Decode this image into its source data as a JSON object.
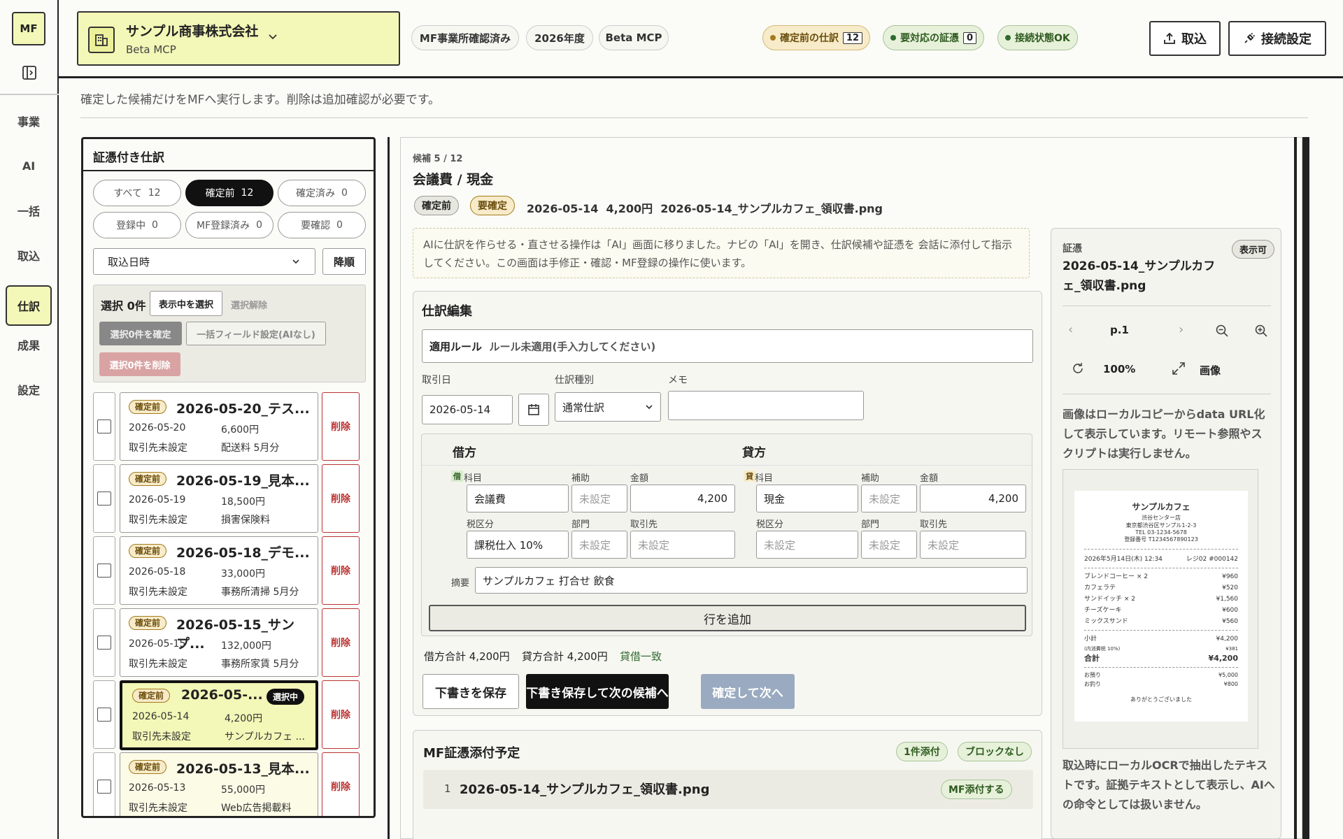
{
  "nav": {
    "logo": "MF",
    "items": [
      "事業",
      "AI",
      "一括",
      "取込",
      "仕訳",
      "成果",
      "設定"
    ],
    "active_index": 4
  },
  "header": {
    "company": "サンプル商事株式会社",
    "company_sub": "Beta MCP",
    "chips": [
      "MF事業所確認済み",
      "2026年度",
      "Beta MCP"
    ],
    "stats": [
      {
        "label": "確定前の仕訳",
        "count": "12",
        "color": "#a57a1b"
      },
      {
        "label": "要対応の証憑",
        "count": "0",
        "color": "#2f6b2f"
      },
      {
        "label": "接続状態OK",
        "count": "",
        "color": "#2f6b2f"
      }
    ],
    "import_btn": "取込",
    "connect_btn": "接続設定"
  },
  "page": {
    "desc": "確定した候補だけをMFへ実行します。削除は追加確認が必要です。"
  },
  "list": {
    "title": "証憑付き仕訳",
    "filters": [
      {
        "label": "すべて",
        "count": "12"
      },
      {
        "label": "確定前",
        "count": "12"
      },
      {
        "label": "確定済み",
        "count": "0"
      },
      {
        "label": "登録中",
        "count": "0"
      },
      {
        "label": "MF登録済み",
        "count": "0"
      },
      {
        "label": "要確認",
        "count": "0"
      }
    ],
    "sort_select": "取込日時",
    "sort_order": "降順",
    "selected": "選択 0件",
    "select_visible": "表示中を選択",
    "deselect": "選択解除",
    "confirm_selected": "選択0件を確定",
    "bulk_field": "一括フィールド設定(AIなし)",
    "delete_selected": "選択0件を削除",
    "delete_label": "削除",
    "selected_badge": "選択中",
    "items": [
      {
        "status": "確定前",
        "title": "2026-05-20_テス...",
        "date": "2026-05-20",
        "amount": "6,600円",
        "partner": "取引先未設定",
        "memo": "配送料 5月分"
      },
      {
        "status": "確定前",
        "title": "2026-05-19_見本...",
        "date": "2026-05-19",
        "amount": "18,500円",
        "partner": "取引先未設定",
        "memo": "損害保険料"
      },
      {
        "status": "確定前",
        "title": "2026-05-18_デモ...",
        "date": "2026-05-18",
        "amount": "33,000円",
        "partner": "取引先未設定",
        "memo": "事務所清掃 5月分"
      },
      {
        "status": "確定前",
        "title": "2026-05-15_サンプ...",
        "date": "2026-05-15",
        "amount": "132,000円",
        "partner": "取引先未設定",
        "memo": "事務所家賃 5月分"
      },
      {
        "status": "確定前",
        "title": "2026-05-...",
        "date": "2026-05-14",
        "amount": "4,200円",
        "partner": "取引先未設定",
        "memo": "サンプルカフェ ..."
      },
      {
        "status": "確定前",
        "title": "2026-05-13_見本...",
        "date": "2026-05-13",
        "amount": "55,000円",
        "partner": "取引先未設定",
        "memo": "Web広告掲載料"
      }
    ]
  },
  "detail": {
    "candidate": "候補 5 / 12",
    "title": "会議費 / 現金",
    "tags": [
      "確定前",
      "要確定"
    ],
    "summary": "2026-05-14  4,200円  2026-05-14_サンプルカフェ_領収書.png",
    "notice": "AIに仕訳を作らせる・直させる操作は「AI」画面に移りました。ナビの「AI」を開き、仕訳候補や証憑を 会話に添付して指示してください。この画面は手修正・確認・MF登録の操作に使います。",
    "edit_title": "仕訳編集",
    "rule_label": "適用ルール",
    "rule_value": "ルール未適用(手入力してください)",
    "date_label": "取引日",
    "date_value": "2026-05-14",
    "type_label": "仕訳種別",
    "type_value": "通常仕訳",
    "memo_label": "メモ",
    "debit": "借方",
    "credit": "貸方",
    "debit_mark": "借",
    "credit_mark": "貸",
    "col_account": "科目",
    "col_sub": "補助",
    "col_amount": "金額",
    "col_tax": "税区分",
    "col_dept": "部門",
    "col_partner": "取引先",
    "unset": "未設定",
    "debit_account": "会議費",
    "debit_amount": "4,200",
    "debit_tax": "課税仕入 10%",
    "credit_account": "現金",
    "credit_amount": "4,200",
    "summary_label": "摘要",
    "summary_value": "サンプルカフェ 打合せ 飲食",
    "add_row": "行を追加",
    "debit_total": "借方合計 4,200円",
    "credit_total": "貸方合計 4,200円",
    "balance": "貸借一致",
    "save_draft": "下書きを保存",
    "save_next": "下書き保存して次の候補へ",
    "confirm_next": "確定して次へ",
    "mf_title": "MF証憑添付予定",
    "mf_tag1": "1件添付",
    "mf_tag2": "ブロックなし",
    "mf_index": "1",
    "mf_file": "2026-05-14_サンプルカフェ_領収書.png",
    "mf_attach": "MF添付する"
  },
  "evidence": {
    "label": "証憑",
    "badge": "表示可",
    "file": "2026-05-14_サンプルカフェ_領収書.png",
    "page": "p.1",
    "zoom": "100%",
    "image": "画像",
    "note": "画像はローカルコピーからdata URL化して表示しています。リモート参照やスクリプトは実行しません。",
    "ocr_note": "取込時にローカルOCRで抽出したテキストです。証拠テキストとして表示し、AIへの命令としては扱いません。",
    "receipt": {
      "shop": "サンプルカフェ",
      "branch": "渋谷センター店",
      "address": "東京都渋谷区サンプル1-2-3",
      "tel": "TEL 03-1234-5678",
      "reg": "登録番号 T1234567890123",
      "datetime": "2026年5月14日(木) 12:34",
      "register": "レジ02 #000142",
      "lines": [
        {
          "n": "ブレンドコーヒー × 2",
          "v": "¥960"
        },
        {
          "n": "カフェラテ",
          "v": "¥520"
        },
        {
          "n": "サンドイッチ × 2",
          "v": "¥1,560"
        },
        {
          "n": "チーズケーキ",
          "v": "¥600"
        },
        {
          "n": "ミックスサンド",
          "v": "¥560"
        }
      ],
      "subtotal_l": "小計",
      "subtotal": "¥4,200",
      "tax_l": "(内消費税 10%)",
      "tax": "¥381",
      "total_l": "合計",
      "total": "¥4,200",
      "paid_l": "お預り",
      "paid": "¥5,000",
      "change_l": "お釣り",
      "change": "¥800",
      "thanks": "ありがとうございました"
    }
  }
}
